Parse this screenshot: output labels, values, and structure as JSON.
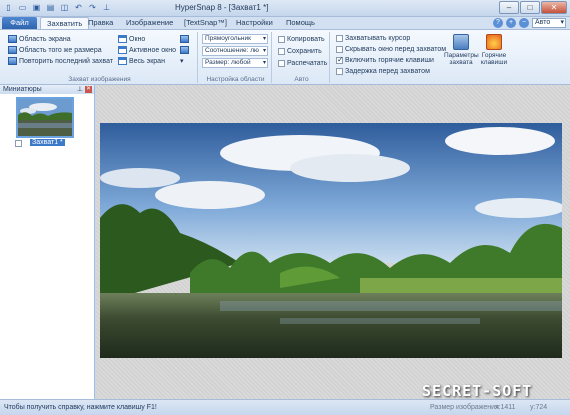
{
  "window": {
    "title": "HyperSnap 8 - [Захват1 *]",
    "controls": [
      "minimize-icon",
      "maximize-icon",
      "close-icon"
    ]
  },
  "quick_access": [
    "new-icon",
    "open-icon",
    "save-icon",
    "print-icon",
    "capture-icon",
    "undo-icon",
    "redo-icon",
    "pin-icon"
  ],
  "tabs": [
    {
      "label": "Файл",
      "active": false
    },
    {
      "label": "Захватить",
      "active": true
    },
    {
      "label": "Правка",
      "active": false
    },
    {
      "label": "Изображение",
      "active": false
    },
    {
      "label": "[TextSnap™]",
      "active": false
    },
    {
      "label": "Настройки",
      "active": false
    },
    {
      "label": "Помощь",
      "active": false
    }
  ],
  "zoom": {
    "value": "Авто"
  },
  "ribbon": {
    "capture_group": {
      "label": "Захват изображения",
      "items": [
        "Область экрана",
        "Область того же размера",
        "Повторить последний захват",
        "Окно",
        "Активное окно",
        "Весь экран"
      ]
    },
    "area_group": {
      "label": "Настройка области",
      "shape": "Прямоугольник",
      "ratio": "Соотношение: лю",
      "size": "Размер: любой"
    },
    "auto_group": {
      "label": "Авто",
      "items": [
        {
          "label": "Копировать",
          "checked": false
        },
        {
          "label": "Сохранить",
          "checked": false
        },
        {
          "label": "Распечатать",
          "checked": false
        }
      ]
    },
    "options": [
      {
        "label": "Захватывать курсор",
        "checked": false
      },
      {
        "label": "Скрывать окно перед захватом",
        "checked": false
      },
      {
        "label": "Включить горячие клавиши",
        "checked": true
      },
      {
        "label": "Задержка перед захватом",
        "checked": false
      }
    ],
    "big_buttons": [
      {
        "label_line1": "Параметры",
        "label_line2": "захвата"
      },
      {
        "label_line1": "Горячие",
        "label_line2": "клавиши"
      }
    ]
  },
  "thumbnails": {
    "title": "Миниатюры",
    "items": [
      {
        "label": "Захват1 *",
        "checked": false
      }
    ]
  },
  "status": {
    "help": "Чтобы получить справку, нажмите клавишу F1!",
    "size_label": "Размер изображения",
    "x": "x:1411",
    "y": "y:724"
  },
  "watermark": "SECRET-SOFT"
}
